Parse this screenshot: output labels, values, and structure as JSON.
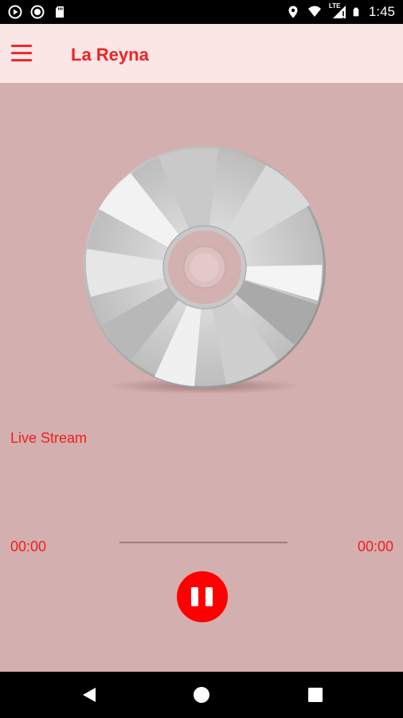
{
  "status_bar": {
    "time": "1:45",
    "network": "LTE",
    "icons": [
      "play-circle-icon",
      "record-icon",
      "sd-card-icon",
      "location-icon",
      "wifi-icon",
      "signal-icon",
      "battery-icon"
    ]
  },
  "app_bar": {
    "title": "La Reyna",
    "menu_icon": "hamburger-menu-icon"
  },
  "player": {
    "artwork": "cd-disc-icon",
    "stream_title": "Live Stream",
    "elapsed": "00:00",
    "duration": "00:00",
    "progress": 0,
    "control_icon": "pause-icon"
  },
  "nav_bar": {
    "icons": [
      "back-icon",
      "home-icon",
      "recents-icon"
    ]
  },
  "colors": {
    "accent": "#ef2323",
    "app_bar_bg": "#fbe6e6",
    "content_bg": "#d4afaf",
    "button_red": "#ff0000"
  }
}
